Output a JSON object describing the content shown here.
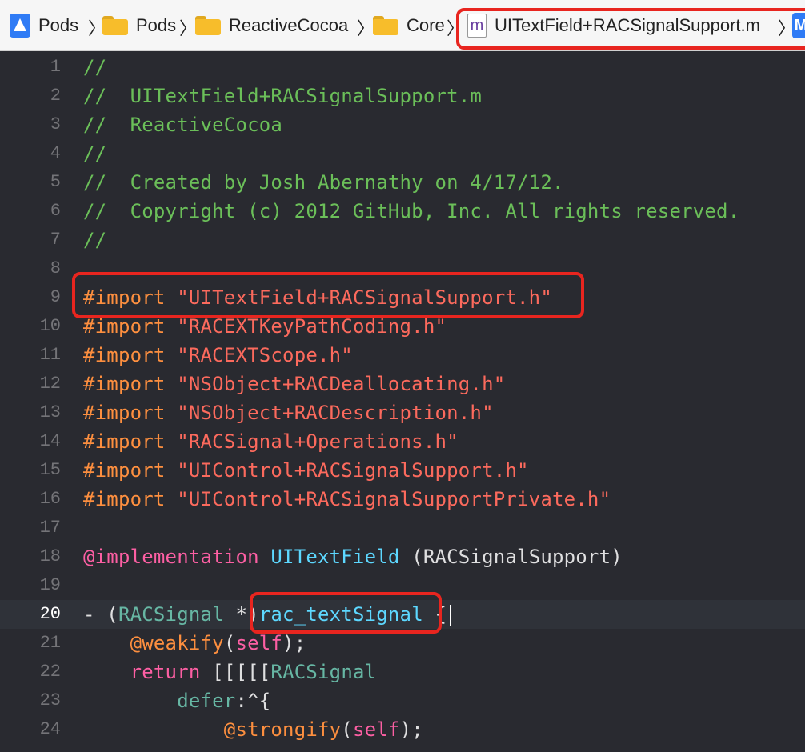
{
  "jumpbar": {
    "crumbs": [
      {
        "label": "Pods",
        "icon": "xcode-project-icon"
      },
      {
        "label": "Pods",
        "icon": "folder-icon"
      },
      {
        "label": "ReactiveCocoa",
        "icon": "folder-icon"
      },
      {
        "label": "Core",
        "icon": "folder-icon"
      },
      {
        "label": "UITextField+RACSignalSupport.m",
        "icon": "objc-file-icon",
        "icon_letter": "m"
      }
    ],
    "separator": "〉",
    "tail_icon_letter": "M"
  },
  "colors": {
    "editor_bg": "#292a30",
    "comment": "#6bbf59",
    "preprocessor": "#fd8f3f",
    "string": "#fc6a5d",
    "keyword": "#fc5fa3",
    "class_name": "#5dd8ff",
    "type": "#d0a8ff",
    "annotation_red": "#e8251f"
  },
  "editor": {
    "lines": [
      {
        "n": "1",
        "parts": [
          {
            "t": "//",
            "c": "com"
          }
        ]
      },
      {
        "n": "2",
        "parts": [
          {
            "t": "//  UITextField+RACSignalSupport.m",
            "c": "com"
          }
        ]
      },
      {
        "n": "3",
        "parts": [
          {
            "t": "//  ReactiveCocoa",
            "c": "com"
          }
        ]
      },
      {
        "n": "4",
        "parts": [
          {
            "t": "//",
            "c": "com"
          }
        ]
      },
      {
        "n": "5",
        "parts": [
          {
            "t": "//  Created by Josh Abernathy on 4/17/12.",
            "c": "com"
          }
        ]
      },
      {
        "n": "6",
        "parts": [
          {
            "t": "//  Copyright (c) 2012 GitHub, Inc. All rights reserved.",
            "c": "com"
          }
        ]
      },
      {
        "n": "7",
        "parts": [
          {
            "t": "//",
            "c": "com"
          }
        ]
      },
      {
        "n": "8",
        "parts": []
      },
      {
        "n": "9",
        "parts": [
          {
            "t": "#import ",
            "c": "pp"
          },
          {
            "t": "\"UITextField+RACSignalSupport.h\"",
            "c": "str"
          }
        ]
      },
      {
        "n": "10",
        "parts": [
          {
            "t": "#import ",
            "c": "pp"
          },
          {
            "t": "\"RACEXTKeyPathCoding.h\"",
            "c": "str"
          }
        ]
      },
      {
        "n": "11",
        "parts": [
          {
            "t": "#import ",
            "c": "pp"
          },
          {
            "t": "\"RACEXTScope.h\"",
            "c": "str"
          }
        ]
      },
      {
        "n": "12",
        "parts": [
          {
            "t": "#import ",
            "c": "pp"
          },
          {
            "t": "\"NSObject+RACDeallocating.h\"",
            "c": "str"
          }
        ]
      },
      {
        "n": "13",
        "parts": [
          {
            "t": "#import ",
            "c": "pp"
          },
          {
            "t": "\"NSObject+RACDescription.h\"",
            "c": "str"
          }
        ]
      },
      {
        "n": "14",
        "parts": [
          {
            "t": "#import ",
            "c": "pp"
          },
          {
            "t": "\"RACSignal+Operations.h\"",
            "c": "str"
          }
        ]
      },
      {
        "n": "15",
        "parts": [
          {
            "t": "#import ",
            "c": "pp"
          },
          {
            "t": "\"UIControl+RACSignalSupport.h\"",
            "c": "str"
          }
        ]
      },
      {
        "n": "16",
        "parts": [
          {
            "t": "#import ",
            "c": "pp"
          },
          {
            "t": "\"UIControl+RACSignalSupportPrivate.h\"",
            "c": "str"
          }
        ]
      },
      {
        "n": "17",
        "parts": []
      },
      {
        "n": "18",
        "parts": [
          {
            "t": "@implementation ",
            "c": "kw"
          },
          {
            "t": "UITextField",
            "c": "cls"
          },
          {
            "t": " (RACSignalSupport)",
            "c": "plain"
          }
        ]
      },
      {
        "n": "19",
        "parts": []
      },
      {
        "n": "20",
        "current": true,
        "parts": [
          {
            "t": "- (",
            "c": "plain"
          },
          {
            "t": "RACSignal",
            "c": "fn"
          },
          {
            "t": " *)",
            "c": "plain"
          },
          {
            "t": "rac_textSignal",
            "c": "cls"
          },
          {
            "t": " {",
            "c": "plain"
          }
        ]
      },
      {
        "n": "21",
        "parts": [
          {
            "t": "    ",
            "c": "plain"
          },
          {
            "t": "@weakify",
            "c": "pp"
          },
          {
            "t": "(",
            "c": "plain"
          },
          {
            "t": "self",
            "c": "kw"
          },
          {
            "t": ");",
            "c": "plain"
          }
        ]
      },
      {
        "n": "22",
        "parts": [
          {
            "t": "    ",
            "c": "plain"
          },
          {
            "t": "return",
            "c": "kw"
          },
          {
            "t": " [[[[[",
            "c": "plain"
          },
          {
            "t": "RACSignal",
            "c": "fn"
          }
        ]
      },
      {
        "n": "23",
        "parts": [
          {
            "t": "        ",
            "c": "plain"
          },
          {
            "t": "defer",
            "c": "fn"
          },
          {
            "t": ":^{",
            "c": "plain"
          }
        ]
      },
      {
        "n": "24",
        "parts": [
          {
            "t": "            ",
            "c": "plain"
          },
          {
            "t": "@strongify",
            "c": "pp"
          },
          {
            "t": "(",
            "c": "plain"
          },
          {
            "t": "self",
            "c": "kw"
          },
          {
            "t": ");",
            "c": "plain"
          }
        ]
      }
    ]
  }
}
